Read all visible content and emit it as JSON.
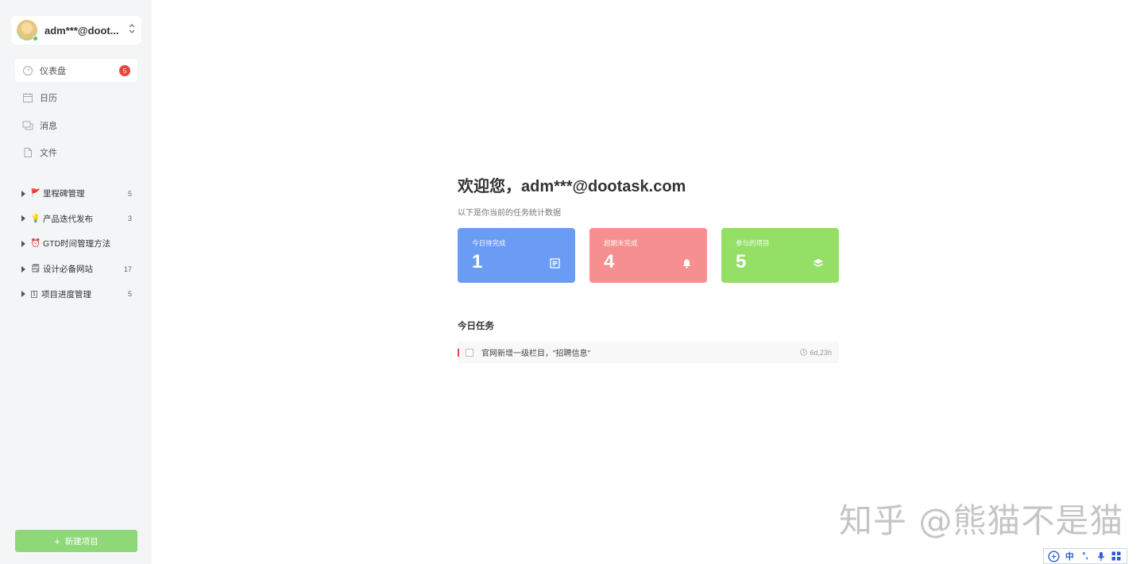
{
  "sidebar": {
    "user": {
      "name": "adm***@doot..."
    },
    "nav": [
      {
        "label": "仪表盘",
        "icon": "dashboard-icon",
        "badge": "5",
        "active": true
      },
      {
        "label": "日历",
        "icon": "calendar-icon"
      },
      {
        "label": "消息",
        "icon": "message-icon"
      },
      {
        "label": "文件",
        "icon": "file-icon"
      }
    ],
    "projects": [
      {
        "emoji": "🚩",
        "label": "里程碑管理",
        "count": "5"
      },
      {
        "emoji": "💡",
        "label": "产品迭代发布",
        "count": "3"
      },
      {
        "emoji": "⏰",
        "label": "GTD时间管理方法",
        "count": ""
      },
      {
        "emoji": "🗒",
        "label": "设计必备网站",
        "count": "17"
      },
      {
        "emoji": "1",
        "label": "项目进度管理",
        "count": "5"
      }
    ],
    "new_project_label": "新建项目"
  },
  "main": {
    "welcome": "欢迎您，adm***@dootask.com",
    "subtitle": "以下是你当前的任务统计数据",
    "cards": [
      {
        "label": "今日待完成",
        "value": "1",
        "color": "#6b9cf4",
        "icon": "list-icon"
      },
      {
        "label": "超期未完成",
        "value": "4",
        "color": "#f68f8f",
        "icon": "bell-icon"
      },
      {
        "label": "参与的项目",
        "value": "5",
        "color": "#94e067",
        "icon": "layers-icon"
      }
    ],
    "today_title": "今日任务",
    "tasks": [
      {
        "text": "官网新增一级栏目，\"招聘信息\"",
        "time": "6d,23h"
      }
    ]
  },
  "watermark": "知乎 @熊猫不是猫",
  "ime": [
    "中",
    "°,"
  ]
}
